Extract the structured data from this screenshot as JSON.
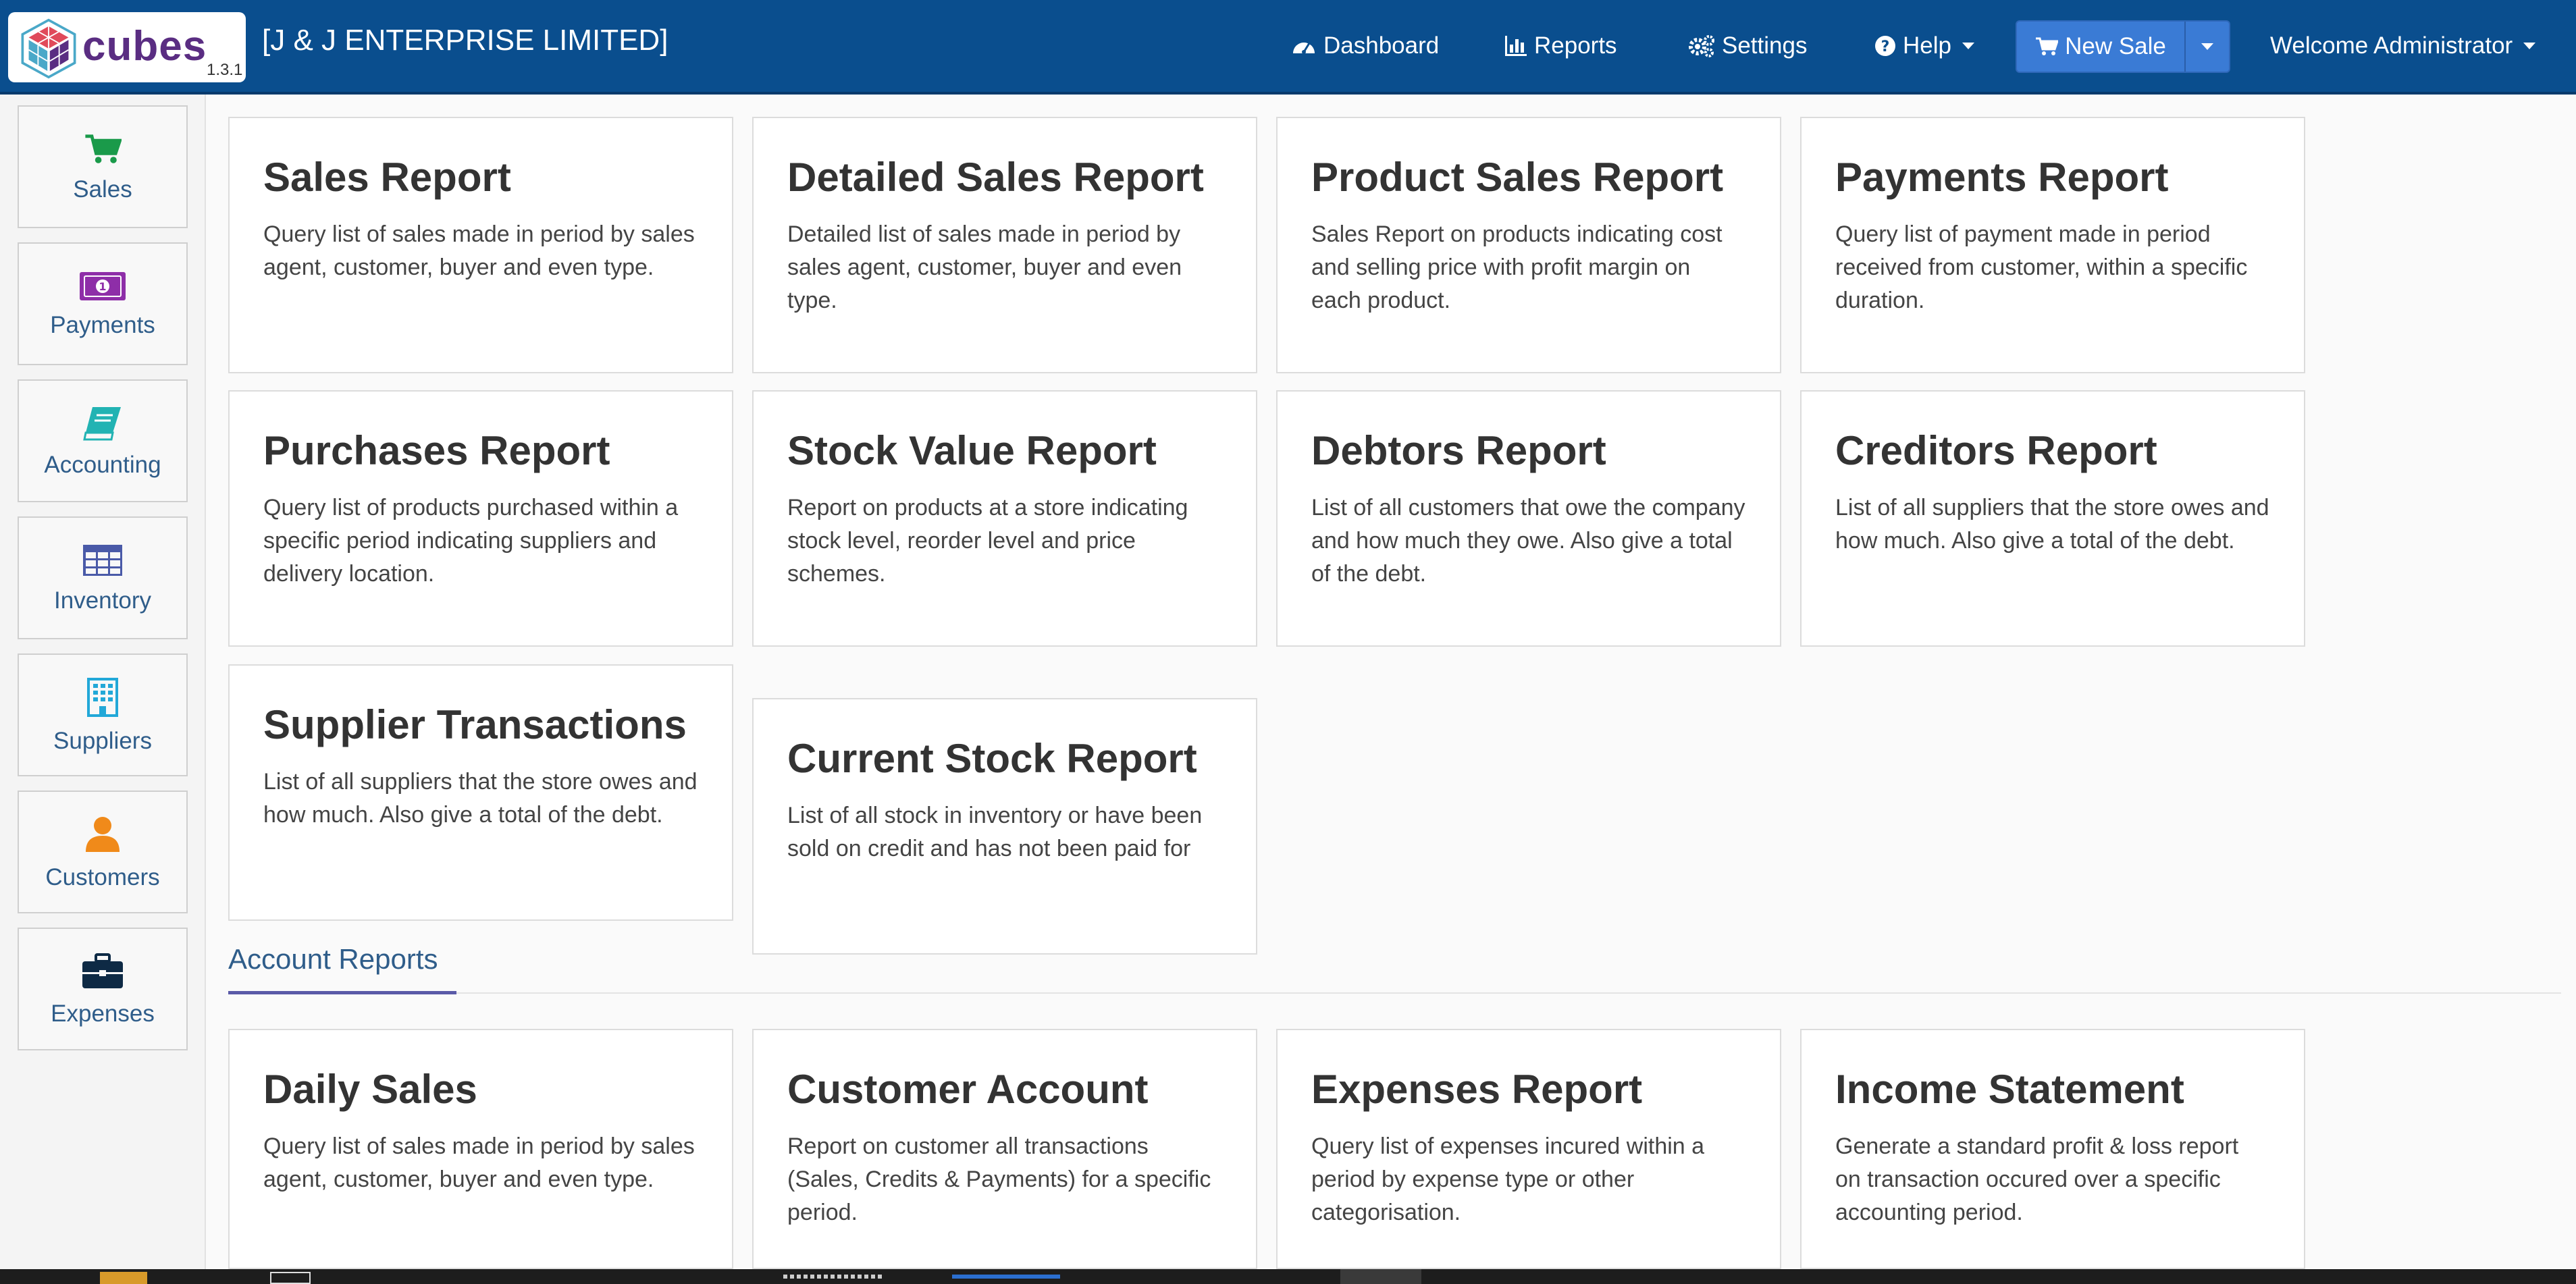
{
  "app": {
    "logo_word": "cubes",
    "version": "1.3.1",
    "company": "[J & J ENTERPRISE LIMITED]"
  },
  "nav": {
    "dashboard": "Dashboard",
    "reports": "Reports",
    "settings": "Settings",
    "help": "Help",
    "new_sale": "New Sale",
    "welcome": "Welcome Administrator"
  },
  "sidebar": {
    "items": [
      {
        "label": "Sales",
        "icon": "cart-icon",
        "color": "#1a9a4a"
      },
      {
        "label": "Payments",
        "icon": "money-icon",
        "color": "#8e2ea8"
      },
      {
        "label": "Accounting",
        "icon": "book-icon",
        "color": "#22b3b3"
      },
      {
        "label": "Inventory",
        "icon": "table-icon",
        "color": "#4a5aa8"
      },
      {
        "label": "Suppliers",
        "icon": "building-icon",
        "color": "#22a8d8"
      },
      {
        "label": "Customers",
        "icon": "user-icon",
        "color": "#f08a1a"
      },
      {
        "label": "Expenses",
        "icon": "briefcase-icon",
        "color": "#0e2a45"
      }
    ]
  },
  "reports": [
    {
      "title": "Sales Report",
      "desc": "Query list of sales made in period by sales agent, customer, buyer and even type."
    },
    {
      "title": "Detailed Sales Report",
      "desc": "Detailed list of sales made in period by sales agent, customer, buyer and even type."
    },
    {
      "title": "Product Sales Report",
      "desc": "Sales Report on products indicating cost and selling price with profit margin on each product."
    },
    {
      "title": "Payments Report",
      "desc": "Query list of payment made in period received from customer, within a specific duration."
    },
    {
      "title": "Purchases Report",
      "desc": "Query list of products purchased within a specific period indicating suppliers and delivery location."
    },
    {
      "title": "Stock Value Report",
      "desc": "Report on products at a store indicating stock level, reorder level and price schemes."
    },
    {
      "title": "Debtors Report",
      "desc": "List of all customers that owe the company and how much they owe. Also give a total of the debt."
    },
    {
      "title": "Creditors Report",
      "desc": "List of all suppliers that the store owes and how much. Also give a total of the debt."
    },
    {
      "title": "Supplier Transactions",
      "desc": "List of all suppliers that the store owes and how much. Also give a total of the debt."
    },
    {
      "title": "Current Stock Report",
      "desc": "List of all stock in inventory or have been sold on credit and has not been paid for"
    }
  ],
  "account_section": {
    "title": "Account Reports"
  },
  "account_reports": [
    {
      "title": "Daily Sales",
      "desc": "Query list of sales made in period by sales agent, customer, buyer and even type."
    },
    {
      "title": "Customer Account",
      "desc": "Report on customer all transactions (Sales, Credits & Payments) for a specific period."
    },
    {
      "title": "Expenses Report",
      "desc": "Query list of expenses incured within a period by expense type or other categorisation."
    },
    {
      "title": "Income Statement",
      "desc": "Generate a standard profit & loss report on transaction occured over a specific accounting period."
    }
  ],
  "colors": {
    "navbar": "#0a4e8e",
    "new_sale": "#3a7bd5",
    "sidebar_label": "#2f5d8a",
    "section_underline": "#5a5aa8"
  }
}
